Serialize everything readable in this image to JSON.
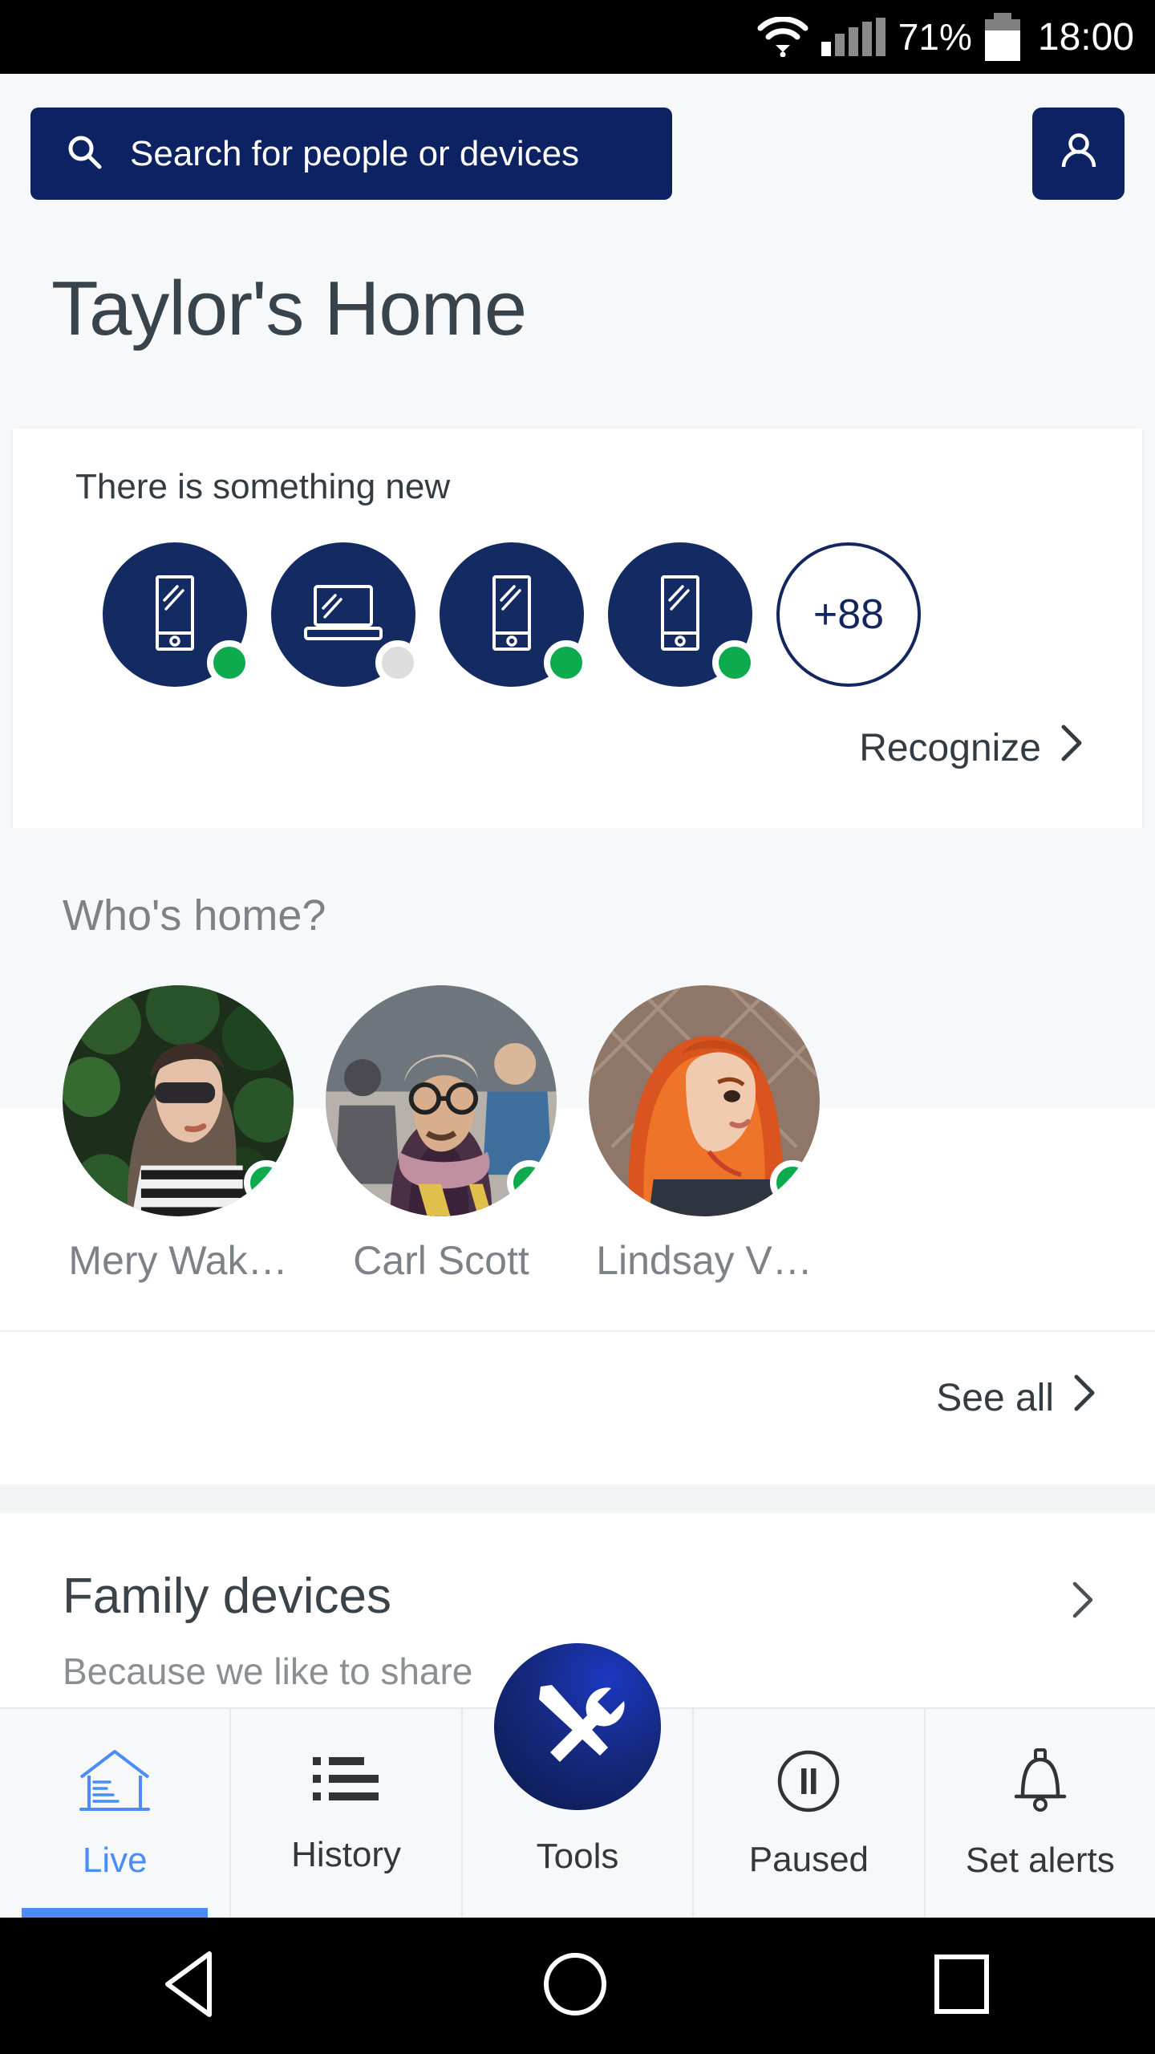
{
  "status_bar": {
    "battery_percent": "71%",
    "time": "18:00",
    "icons": [
      "wifi-icon",
      "cellular-signal-icon",
      "battery-icon"
    ]
  },
  "search": {
    "placeholder": "Search for people or devices",
    "icon": "search-icon"
  },
  "profile": {
    "icon": "account-icon"
  },
  "header": {
    "title": "Taylor's Home"
  },
  "new_devices_card": {
    "heading": "There is something new",
    "devices": [
      {
        "icon": "phone-icon",
        "status": "online",
        "status_color": "#0eab4e"
      },
      {
        "icon": "laptop-icon",
        "status": "offline",
        "status_color": "#dddddd"
      },
      {
        "icon": "phone-icon",
        "status": "online",
        "status_color": "#0eab4e"
      },
      {
        "icon": "phone-icon",
        "status": "online",
        "status_color": "#0eab4e"
      }
    ],
    "more_count": "+88",
    "action_label": "Recognize",
    "action_icon": "chevron-right-icon"
  },
  "whos_home": {
    "title": "Who's home?",
    "people": [
      {
        "name": "Mery Wak…",
        "status": "online",
        "avatar": "woman-sunglasses-photo"
      },
      {
        "name": "Carl Scott",
        "status": "online",
        "avatar": "man-glasses-scarf-photo"
      },
      {
        "name": "Lindsay V…",
        "status": "online",
        "avatar": "woman-red-hair-photo"
      }
    ],
    "see_all_label": "See all",
    "see_all_icon": "chevron-right-icon"
  },
  "family_devices": {
    "title": "Family devices",
    "subtitle": "Because we like to share",
    "chevron": "chevron-right-icon"
  },
  "tab_bar": {
    "active_color": "#4b8df8",
    "tabs": [
      {
        "label": "Live",
        "icon": "home-icon",
        "active": true
      },
      {
        "label": "History",
        "icon": "list-icon",
        "active": false
      },
      {
        "label": "Tools",
        "icon": "tools-icon",
        "active": false
      },
      {
        "label": "Paused",
        "icon": "pause-circle-icon",
        "active": false
      },
      {
        "label": "Set alerts",
        "icon": "bell-icon",
        "active": false
      }
    ]
  },
  "android_nav": {
    "back": "back-triangle-icon",
    "home": "home-circle-icon",
    "recents": "recents-square-icon"
  }
}
